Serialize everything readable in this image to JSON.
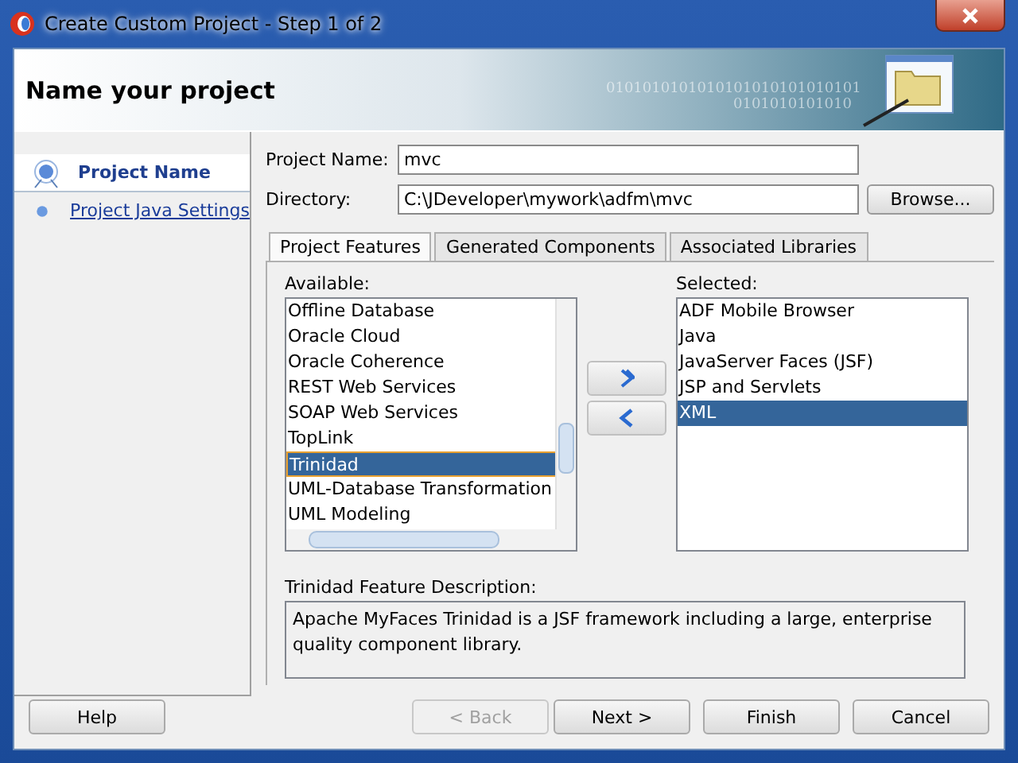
{
  "window": {
    "title": "Create Custom Project - Step 1 of 2"
  },
  "header": {
    "title": "Name your project",
    "binary_pattern": [
      "0101010101010101010101010101",
      "0101010101010"
    ]
  },
  "steps": [
    {
      "label": "Project Name",
      "selected": true
    },
    {
      "label": "Project Java Settings",
      "selected": false
    }
  ],
  "form": {
    "project_name": {
      "label": "Project Name:",
      "value": "mvc"
    },
    "directory": {
      "label": "Directory:",
      "value": "C:\\JDeveloper\\mywork\\adfm\\mvc"
    },
    "browse_button": "Browse..."
  },
  "tabs": [
    {
      "label": "Project Features",
      "selected": true
    },
    {
      "label": "Generated Components",
      "selected": false
    },
    {
      "label": "Associated Libraries",
      "selected": false
    }
  ],
  "available": {
    "label": "Available:",
    "items": [
      {
        "label": "Offline Database",
        "selected": false
      },
      {
        "label": "Oracle Cloud",
        "selected": false
      },
      {
        "label": "Oracle Coherence",
        "selected": false
      },
      {
        "label": "REST Web Services",
        "selected": false
      },
      {
        "label": "SOAP Web Services",
        "selected": false
      },
      {
        "label": "TopLink",
        "selected": false
      },
      {
        "label": "Trinidad",
        "selected": true
      },
      {
        "label": "UML-Database Transformation",
        "selected": false
      },
      {
        "label": "UML Modeling",
        "selected": false
      }
    ]
  },
  "selected_list": {
    "label": "Selected:",
    "items": [
      {
        "label": "ADF Mobile Browser",
        "selected": false
      },
      {
        "label": "Java",
        "selected": false
      },
      {
        "label": "JavaServer Faces (JSF)",
        "selected": false
      },
      {
        "label": "JSP and Servlets",
        "selected": false
      },
      {
        "label": "XML",
        "selected": true
      }
    ]
  },
  "description": {
    "label": "Trinidad Feature Description:",
    "text": "Apache MyFaces Trinidad is a JSF framework including a large, enterprise quality component library."
  },
  "buttons": [
    {
      "label": "Help",
      "disabled": false
    },
    {
      "label": "< Back",
      "disabled": true
    },
    {
      "label": "Next >",
      "disabled": false
    },
    {
      "label": "Finish",
      "disabled": false
    },
    {
      "label": "Cancel",
      "disabled": false
    }
  ]
}
